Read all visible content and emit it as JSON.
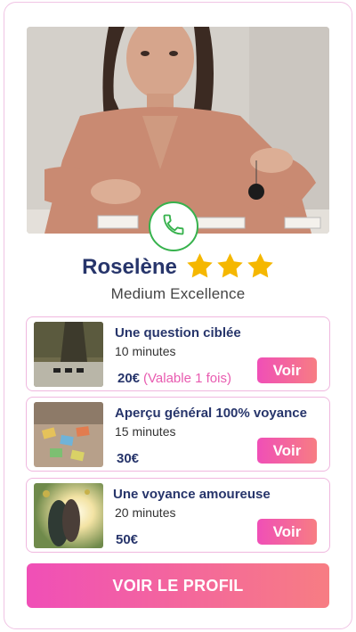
{
  "seer": {
    "name": "Roselène",
    "rating_stars": 3,
    "title": "Medium Excellence"
  },
  "call_icon": "phone-icon",
  "offers": [
    {
      "title": "Une question ciblée",
      "duration": "10 minutes",
      "price": "20€",
      "note": "(Valable 1 fois)",
      "button": "Voir"
    },
    {
      "title": "Aperçu général 100% voyance",
      "duration": "15 minutes",
      "price": "30€",
      "note": "",
      "button": "Voir"
    },
    {
      "title": "Une voyance amoureuse",
      "duration": "20 minutes",
      "price": "50€",
      "note": "",
      "button": "Voir"
    }
  ],
  "profile_button": "VOIR LE PROFIL",
  "colors": {
    "accent_start": "#f04fb7",
    "accent_end": "#f77d83",
    "navy": "#27356b",
    "star": "#f5b700",
    "phone_green": "#37b24d"
  }
}
